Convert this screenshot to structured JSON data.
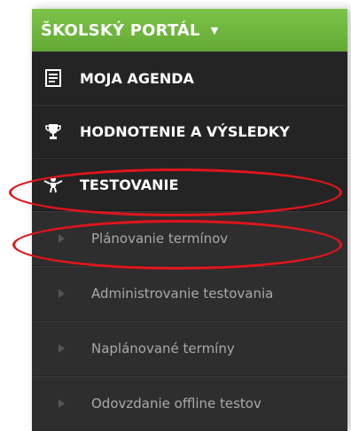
{
  "header": {
    "title": "ŠKOLSKÝ PORTÁL",
    "caret": "▼"
  },
  "main_items": [
    {
      "label": "MOJA AGENDA",
      "icon": "agenda-icon"
    },
    {
      "label": "HODNOTENIE A VÝSLEDKY",
      "icon": "trophy-icon"
    },
    {
      "label": "TESTOVANIE",
      "icon": "testing-person-icon"
    }
  ],
  "sub_items": [
    {
      "label": "Plánovanie termínov"
    },
    {
      "label": "Administrovanie testovania"
    },
    {
      "label": "Naplánované termíny"
    },
    {
      "label": "Odovzdanie offline testov"
    }
  ],
  "colors": {
    "header_green": "#6cb63b",
    "menu_bg": "#2c2c2c",
    "highlight_red": "#e0151c"
  }
}
